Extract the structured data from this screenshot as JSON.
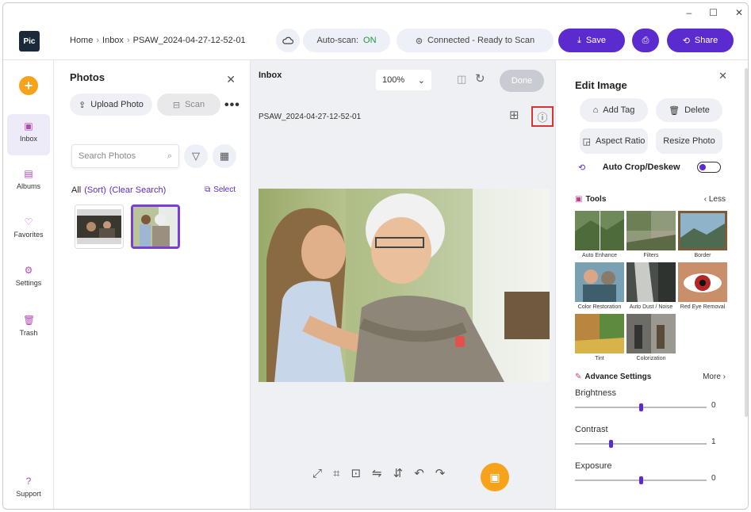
{
  "window": {
    "minimize": "–",
    "maximize": "☐",
    "close": "✕"
  },
  "app": {
    "logo": "Pic"
  },
  "breadcrumb": {
    "home": "Home",
    "inbox": "Inbox",
    "file": "PSAW_2024-04-27-12-52-01"
  },
  "header": {
    "autoscan_label": "Auto-scan:",
    "autoscan_value": "ON",
    "connection": "Connected - Ready to Scan",
    "save": "Save",
    "share": "Share"
  },
  "nav": {
    "items": [
      {
        "label": "Inbox",
        "icon": "inbox-icon"
      },
      {
        "label": "Albums",
        "icon": "albums-icon"
      },
      {
        "label": "Favorites",
        "icon": "heart-icon"
      },
      {
        "label": "Settings",
        "icon": "gear-icon"
      },
      {
        "label": "Trash",
        "icon": "trash-icon"
      },
      {
        "label": "Support",
        "icon": "help-icon"
      }
    ]
  },
  "photos_panel": {
    "title": "Photos",
    "upload": "Upload Photo",
    "scan": "Scan",
    "search_placeholder": "Search Photos",
    "filter_all": "All",
    "filter_sort": "(Sort)",
    "filter_clear": "(Clear Search)",
    "select": "Select"
  },
  "center": {
    "label": "Inbox",
    "zoom": "100%",
    "done": "Done",
    "filename": "PSAW_2024-04-27-12-52-01"
  },
  "edit": {
    "title": "Edit Image",
    "add_tag": "Add Tag",
    "delete": "Delete",
    "aspect_ratio": "Aspect Ratio",
    "resize": "Resize Photo",
    "auto_crop": "Auto Crop/Deskew",
    "tools_title": "Tools",
    "tools_less": "Less",
    "tools": [
      {
        "label": "Auto Enhance"
      },
      {
        "label": "Filters"
      },
      {
        "label": "Border"
      },
      {
        "label": "Color Restoration"
      },
      {
        "label": "Auto Dust / Noise"
      },
      {
        "label": "Red Eye Removal"
      },
      {
        "label": "Tint"
      },
      {
        "label": "Colorization"
      }
    ],
    "advance_title": "Advance Settings",
    "more": "More",
    "sliders": [
      {
        "label": "Brightness",
        "value": "0",
        "position": 0.5
      },
      {
        "label": "Contrast",
        "value": "1",
        "position": 0.27
      },
      {
        "label": "Exposure",
        "value": "0",
        "position": 0.5
      }
    ]
  },
  "colors": {
    "accent": "#5b2bd0",
    "orange": "#f6a21b",
    "status_on": "#1a9b3c"
  }
}
